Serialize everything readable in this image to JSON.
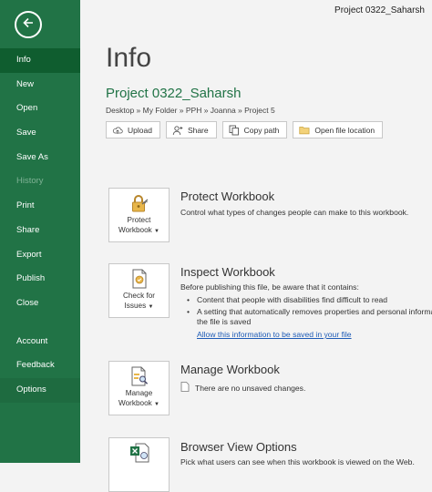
{
  "window": {
    "title": "Project 0322_Saharsh"
  },
  "sidebar": {
    "items": [
      {
        "label": "Info"
      },
      {
        "label": "New"
      },
      {
        "label": "Open"
      },
      {
        "label": "Save"
      },
      {
        "label": "Save As"
      },
      {
        "label": "History"
      },
      {
        "label": "Print"
      },
      {
        "label": "Share"
      },
      {
        "label": "Export"
      },
      {
        "label": "Publish"
      },
      {
        "label": "Close"
      },
      {
        "label": "Account"
      },
      {
        "label": "Feedback"
      },
      {
        "label": "Options"
      }
    ]
  },
  "main": {
    "title": "Info",
    "file_name": "Project 0322_Saharsh",
    "breadcrumb": "Desktop » My Folder » PPH » Joanna » Project 5",
    "actions": {
      "upload": "Upload",
      "share": "Share",
      "copy_path": "Copy path",
      "open_location": "Open file location"
    },
    "protect": {
      "button_line1": "Protect",
      "button_line2": "Workbook",
      "title": "Protect Workbook",
      "description": "Control what types of changes people can make to this workbook."
    },
    "inspect": {
      "button_line1": "Check for",
      "button_line2": "Issues",
      "title": "Inspect Workbook",
      "description": "Before publishing this file, be aware that it contains:",
      "bullet1": "Content that people with disabilities find difficult to read",
      "bullet2_line1": "A setting that automatically removes properties and personal informa",
      "bullet2_line2": "the file is saved",
      "link": "Allow this information to be saved in your file"
    },
    "manage": {
      "button_line1": "Manage",
      "button_line2": "Workbook",
      "title": "Manage Workbook",
      "status": "There are no unsaved changes."
    },
    "browser": {
      "title": "Browser View Options",
      "description": "Pick what users can see when this workbook is viewed on the Web."
    }
  },
  "colors": {
    "accent": "#217346",
    "active_nav": "#0f5d2f",
    "link": "#1e5bb6"
  },
  "icons": {
    "back": "back-arrow-icon",
    "upload": "cloud-upload-icon",
    "share": "person-add-icon",
    "copy_path": "copy-path-icon",
    "open_location": "folder-icon",
    "protect": "lock-key-icon",
    "inspect": "document-check-icon",
    "manage": "search-document-icon",
    "browser": "excel-globe-icon",
    "status": "document-icon"
  }
}
